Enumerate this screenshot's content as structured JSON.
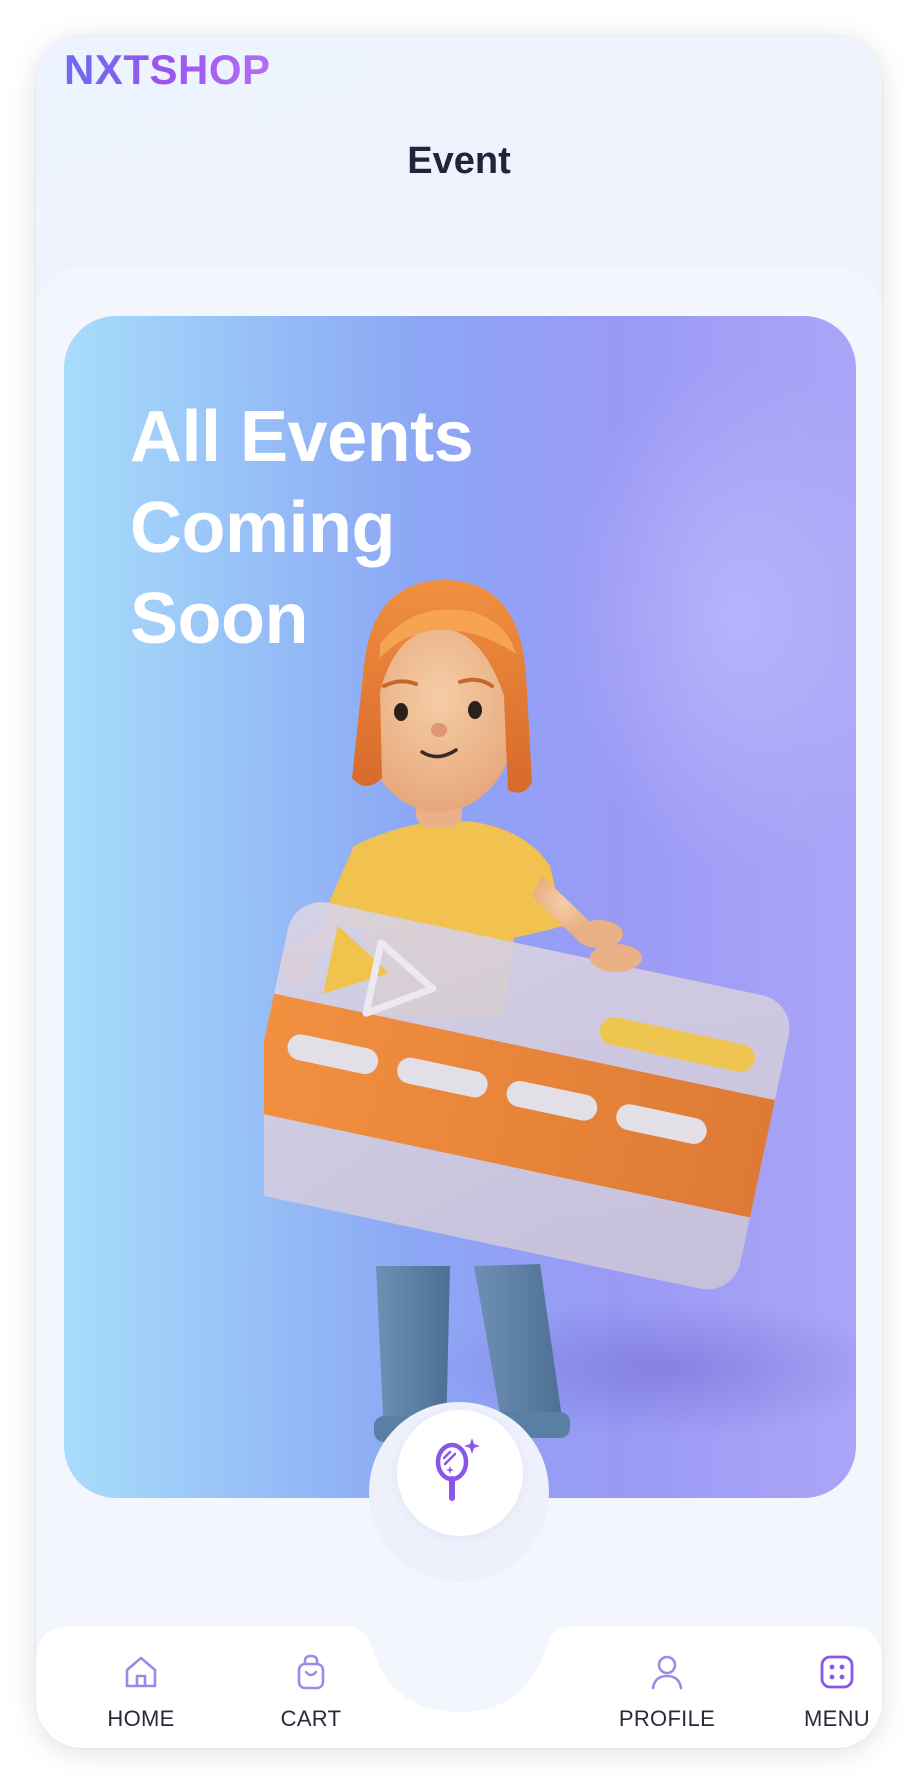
{
  "app": {
    "logo_text": "NXTSHOP"
  },
  "header": {
    "title": "Event"
  },
  "banner": {
    "headline_line1": "All Events",
    "headline_line2": "Coming",
    "headline_line3": "Soon",
    "illustration": "girl-holding-credit-card-illustration"
  },
  "fab": {
    "icon": "magic-mirror-sparkle-icon"
  },
  "bottom_nav": {
    "items": [
      {
        "label": "HOME",
        "icon": "home-icon"
      },
      {
        "label": "CART",
        "icon": "shopping-bag-icon"
      },
      {
        "label": "PROFILE",
        "icon": "user-icon"
      },
      {
        "label": "MENU",
        "icon": "menu-grid-icon"
      }
    ]
  },
  "colors": {
    "accent": "#8a55ea",
    "text_dark": "#22243a",
    "icon_stroke": "#9b8ae6"
  }
}
